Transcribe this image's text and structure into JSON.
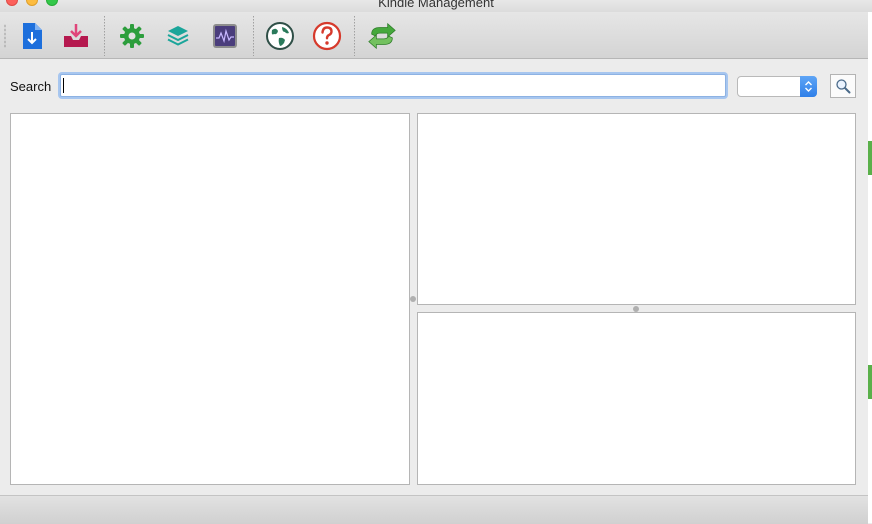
{
  "window": {
    "title": "Kindle Management"
  },
  "toolbar": {
    "buttons": [
      {
        "icon": "download-file-icon",
        "color": "#1d6fdc"
      },
      {
        "icon": "inbox-download-icon",
        "color": "#b5194f"
      },
      {
        "icon": "gear-icon",
        "color": "#2d9e3d"
      },
      {
        "icon": "layers-icon",
        "color": "#1aa59a"
      },
      {
        "icon": "activity-monitor-icon",
        "color": "#6f5aa8"
      },
      {
        "icon": "globe-icon",
        "color": "#2a7a5b"
      },
      {
        "icon": "help-icon",
        "color": "#d63a2c"
      },
      {
        "icon": "sync-icon",
        "color": "#45a83c"
      }
    ]
  },
  "search": {
    "label": "Search",
    "value": "",
    "filter_selected": ""
  },
  "colors": {
    "accent_focus": "#8db2e3",
    "select_blue": "#2f7fe8",
    "edge_green": "#5ab04a"
  }
}
